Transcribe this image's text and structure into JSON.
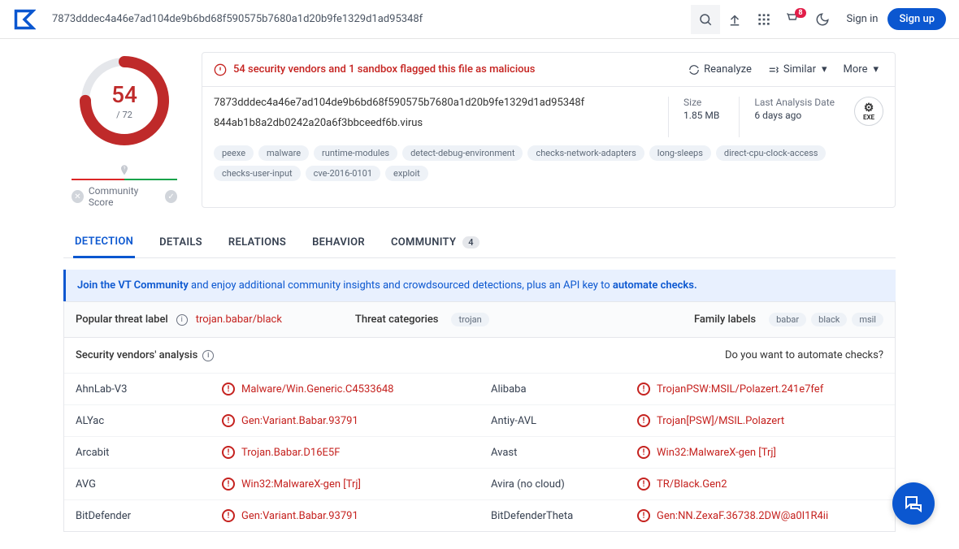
{
  "header": {
    "search_value": "7873dddec4a46e7ad104de9b6bd68f590575b7680a1d20b9fe1329d1ad95348f",
    "notification_count": "8",
    "signin": "Sign in",
    "signup": "Sign up"
  },
  "score": {
    "detected": "54",
    "total": "/ 72",
    "community_label": "Community Score"
  },
  "summary": {
    "flag_text": "54 security vendors and 1 sandbox flagged this file as malicious",
    "reanalyze": "Reanalyze",
    "similar": "Similar",
    "more": "More",
    "hash": "7873dddec4a46e7ad104de9b6bd68f590575b7680a1d20b9fe1329d1ad95348f",
    "filename": "844ab1b8a2db0242a20a6f3bbceedf6b.virus",
    "size_label": "Size",
    "size_value": "1.85 MB",
    "date_label": "Last Analysis Date",
    "date_value": "6 days ago",
    "filetype": "EXE"
  },
  "tags": [
    "peexe",
    "malware",
    "runtime-modules",
    "detect-debug-environment",
    "checks-network-adapters",
    "long-sleeps",
    "direct-cpu-clock-access",
    "checks-user-input",
    "cve-2016-0101",
    "exploit"
  ],
  "tabs": {
    "detection": "DETECTION",
    "details": "DETAILS",
    "relations": "RELATIONS",
    "behavior": "BEHAVIOR",
    "community": "COMMUNITY",
    "community_count": "4"
  },
  "banner": {
    "pre": "Join the VT Community",
    "mid": " and enjoy additional community insights and crowdsourced detections, plus an API key to ",
    "post": "automate checks."
  },
  "threat": {
    "popular_label": "Popular threat label",
    "popular_value": "trojan.babar/black",
    "cat_label": "Threat categories",
    "cat_values": [
      "trojan"
    ],
    "family_label": "Family labels",
    "family_values": [
      "babar",
      "black",
      "msil"
    ]
  },
  "analysis": {
    "title": "Security vendors' analysis",
    "right": "Do you want to automate checks?"
  },
  "vendors": [
    {
      "name": "AhnLab-V3",
      "result": "Malware/Win.Generic.C4533648"
    },
    {
      "name": "Alibaba",
      "result": "TrojanPSW:MSIL/Polazert.241e7fef"
    },
    {
      "name": "ALYac",
      "result": "Gen:Variant.Babar.93791"
    },
    {
      "name": "Antiy-AVL",
      "result": "Trojan[PSW]/MSIL.Polazert"
    },
    {
      "name": "Arcabit",
      "result": "Trojan.Babar.D16E5F"
    },
    {
      "name": "Avast",
      "result": "Win32:MalwareX-gen [Trj]"
    },
    {
      "name": "AVG",
      "result": "Win32:MalwareX-gen [Trj]"
    },
    {
      "name": "Avira (no cloud)",
      "result": "TR/Black.Gen2"
    },
    {
      "name": "BitDefender",
      "result": "Gen:Variant.Babar.93791"
    },
    {
      "name": "BitDefenderTheta",
      "result": "Gen:NN.ZexaF.36738.2DW@a0I1R4ii"
    }
  ]
}
